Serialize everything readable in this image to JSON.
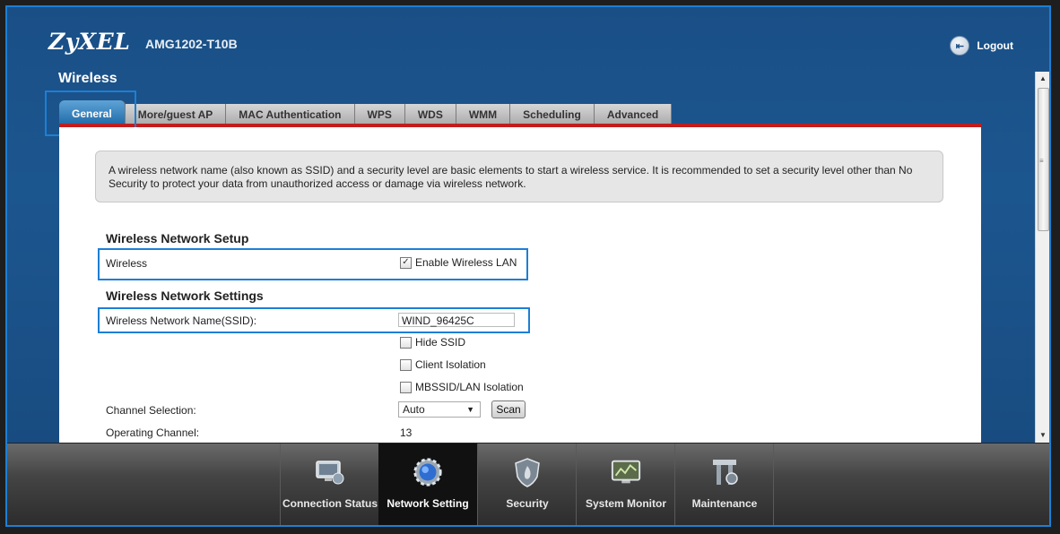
{
  "header": {
    "brand": "ZyXEL",
    "model": "AMG1202-T10B",
    "logout_label": "Logout"
  },
  "page_title": "Wireless",
  "tabs": [
    "General",
    "More/guest AP",
    "MAC Authentication",
    "WPS",
    "WDS",
    "WMM",
    "Scheduling",
    "Advanced"
  ],
  "info_text": "A wireless network name (also known as SSID) and a security level are basic elements to start a wireless service. It is recommended to set a security level other than No Security to protect your data from unauthorized access or damage via wireless network.",
  "setup": {
    "title": "Wireless Network Setup",
    "wireless_label": "Wireless",
    "enable_label": "Enable Wireless LAN",
    "enable_checked": true
  },
  "settings": {
    "title": "Wireless Network Settings",
    "ssid_label": "Wireless Network Name(SSID):",
    "ssid_value": "WIND_96425C",
    "hide_ssid": "Hide SSID",
    "client_isolation": "Client Isolation",
    "mbssid_isolation": "MBSSID/LAN Isolation",
    "channel_label": "Channel Selection:",
    "channel_value": "Auto",
    "scan_label": "Scan",
    "operating_label": "Operating Channel:",
    "operating_value": "13"
  },
  "bottom_nav": [
    {
      "label": "Connection Status",
      "icon": "monitor-icon"
    },
    {
      "label": "Network Setting",
      "icon": "gear-globe-icon"
    },
    {
      "label": "Security",
      "icon": "shield-flame-icon"
    },
    {
      "label": "System Monitor",
      "icon": "chart-monitor-icon"
    },
    {
      "label": "Maintenance",
      "icon": "tools-icon"
    }
  ],
  "colors": {
    "accent": "#1d7fd4",
    "header_bg": "#1a4f86",
    "tab_rule": "#c21d1d"
  }
}
